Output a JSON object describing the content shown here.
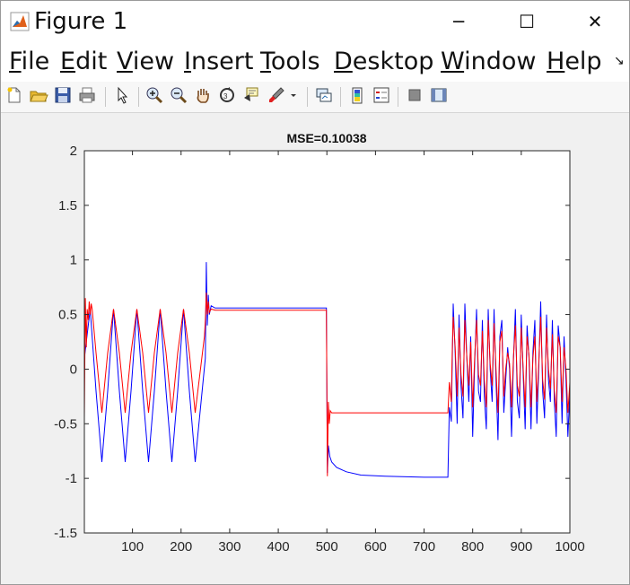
{
  "window": {
    "title": "Figure 1",
    "minimize_glyph": "─",
    "maximize_glyph": "☐",
    "close_glyph": "✕"
  },
  "menubar": {
    "items": [
      {
        "u": "F",
        "rest": "ile"
      },
      {
        "u": "E",
        "rest": "dit"
      },
      {
        "u": "V",
        "rest": "iew"
      },
      {
        "u": "I",
        "rest": "nsert"
      },
      {
        "u": "T",
        "rest": "ools"
      },
      {
        "u": "D",
        "rest": "esktop"
      },
      {
        "u": "W",
        "rest": "indow"
      },
      {
        "u": "H",
        "rest": "elp"
      }
    ],
    "more_glyph": "↘"
  },
  "toolbar": {
    "icons": [
      "new-figure-icon",
      "open-file-icon",
      "save-icon",
      "print-icon",
      "pointer-icon",
      "zoom-in-icon",
      "zoom-out-icon",
      "pan-hand-icon",
      "rotate-3d-icon",
      "data-cursor-icon",
      "brush-icon",
      "link-plot-icon",
      "colorbar-icon",
      "legend-icon",
      "hide-plot-tools-icon",
      "show-plot-tools-icon"
    ]
  },
  "chart_data": {
    "type": "line",
    "title": "MSE=0.10038",
    "xlabel": "",
    "ylabel": "",
    "xlim": [
      1,
      1000
    ],
    "ylim": [
      -1.5,
      2
    ],
    "xticks": [
      100,
      200,
      300,
      400,
      500,
      600,
      700,
      800,
      900,
      1000
    ],
    "yticks": [
      -1.5,
      -1,
      -0.5,
      0,
      0.5,
      1,
      1.5,
      2
    ],
    "grid": false,
    "legend": "none",
    "series": [
      {
        "color": "#0000ff",
        "x": [
          1,
          13,
          25,
          37,
          49,
          61,
          73,
          85,
          97,
          109,
          121,
          133,
          145,
          157,
          169,
          181,
          193,
          205,
          217,
          229,
          250,
          252,
          254,
          256,
          258,
          262,
          270,
          350,
          499,
          501,
          503,
          506,
          510,
          520,
          540,
          570,
          620,
          700,
          749,
          752,
          756,
          758,
          760,
          764,
          768,
          772,
          776,
          780,
          784,
          788,
          792,
          796,
          800,
          804,
          808,
          812,
          816,
          820,
          824,
          828,
          832,
          836,
          840,
          844,
          848,
          852,
          856,
          860,
          864,
          868,
          872,
          876,
          880,
          884,
          888,
          892,
          896,
          900,
          904,
          908,
          912,
          916,
          920,
          924,
          928,
          932,
          936,
          940,
          944,
          948,
          952,
          956,
          960,
          964,
          968,
          972,
          976,
          980,
          984,
          988,
          992,
          996,
          1000
        ],
        "y": [
          0.1,
          0.55,
          -0.2,
          -0.85,
          -0.2,
          0.55,
          -0.2,
          -0.85,
          -0.2,
          0.55,
          -0.2,
          -0.85,
          -0.2,
          0.55,
          -0.2,
          -0.85,
          -0.2,
          0.55,
          -0.2,
          -0.85,
          0.1,
          0.98,
          0.4,
          0.68,
          0.5,
          0.58,
          0.56,
          0.56,
          0.56,
          -0.95,
          -0.7,
          -0.8,
          -0.85,
          -0.9,
          -0.94,
          -0.97,
          -0.98,
          -0.99,
          -0.99,
          -0.35,
          -0.48,
          0.05,
          0.6,
          0.15,
          -0.5,
          0.5,
          -0.15,
          -0.45,
          0.6,
          0.1,
          -0.3,
          0.3,
          -0.62,
          0.05,
          0.55,
          -0.2,
          -0.3,
          0.45,
          -0.25,
          -0.55,
          0.55,
          0.0,
          -0.3,
          0.55,
          -0.1,
          -0.65,
          0.3,
          0.45,
          -0.4,
          -0.1,
          0.2,
          0.0,
          -0.62,
          0.1,
          0.55,
          -0.3,
          -0.45,
          0.5,
          -0.05,
          -0.55,
          0.4,
          0.1,
          -0.55,
          0.15,
          0.45,
          -0.5,
          0.0,
          0.62,
          -0.2,
          -0.45,
          0.5,
          -0.1,
          -0.3,
          0.45,
          -0.3,
          -0.62,
          0.4,
          0.2,
          -0.5,
          0.3,
          -0.1,
          -0.62,
          -0.2
        ]
      },
      {
        "color": "#ff0000",
        "x": [
          1,
          3,
          5,
          7,
          9,
          11,
          13,
          15,
          17,
          25,
          37,
          49,
          61,
          73,
          85,
          97,
          109,
          121,
          133,
          145,
          157,
          169,
          181,
          193,
          205,
          217,
          229,
          248,
          250,
          252,
          254,
          256,
          258,
          262,
          270,
          350,
          499,
          501,
          503,
          505,
          507,
          510,
          520,
          600,
          700,
          749,
          752,
          756,
          758,
          760,
          764,
          768,
          772,
          776,
          780,
          784,
          788,
          792,
          796,
          800,
          804,
          808,
          812,
          816,
          820,
          824,
          828,
          832,
          836,
          840,
          844,
          848,
          852,
          856,
          860,
          864,
          868,
          872,
          876,
          880,
          884,
          888,
          892,
          896,
          900,
          904,
          908,
          912,
          916,
          920,
          924,
          928,
          932,
          936,
          940,
          944,
          948,
          952,
          956,
          960,
          964,
          968,
          972,
          976,
          980,
          984,
          988,
          992,
          996,
          1000
        ],
        "y": [
          -0.45,
          0.65,
          0.2,
          0.55,
          0.45,
          0.62,
          0.5,
          0.6,
          0.55,
          0.15,
          -0.4,
          0.15,
          0.55,
          0.15,
          -0.4,
          0.15,
          0.55,
          0.15,
          -0.4,
          0.15,
          0.55,
          0.15,
          -0.4,
          0.15,
          0.55,
          0.15,
          -0.4,
          0.3,
          0.45,
          0.7,
          0.5,
          0.62,
          0.52,
          0.55,
          0.54,
          0.54,
          0.54,
          -0.98,
          -0.3,
          -0.5,
          -0.38,
          -0.4,
          -0.4,
          -0.4,
          -0.4,
          -0.4,
          -0.12,
          -0.3,
          0.15,
          0.48,
          0.2,
          -0.25,
          0.38,
          -0.05,
          -0.25,
          0.45,
          0.1,
          -0.15,
          0.25,
          -0.35,
          0.1,
          0.45,
          -0.05,
          -0.15,
          0.35,
          -0.1,
          -0.35,
          0.45,
          0.05,
          -0.15,
          0.42,
          0.0,
          -0.4,
          0.25,
          0.35,
          -0.25,
          0.0,
          0.15,
          0.05,
          -0.35,
          0.12,
          0.4,
          -0.15,
          -0.25,
          0.38,
          0.0,
          -0.35,
          0.3,
          0.12,
          -0.35,
          0.1,
          0.3,
          -0.3,
          0.05,
          0.48,
          -0.1,
          -0.28,
          0.38,
          0.0,
          -0.18,
          0.32,
          -0.2,
          -0.4,
          0.3,
          0.2,
          -0.3,
          0.2,
          0.0,
          -0.4,
          -0.12
        ]
      }
    ]
  }
}
